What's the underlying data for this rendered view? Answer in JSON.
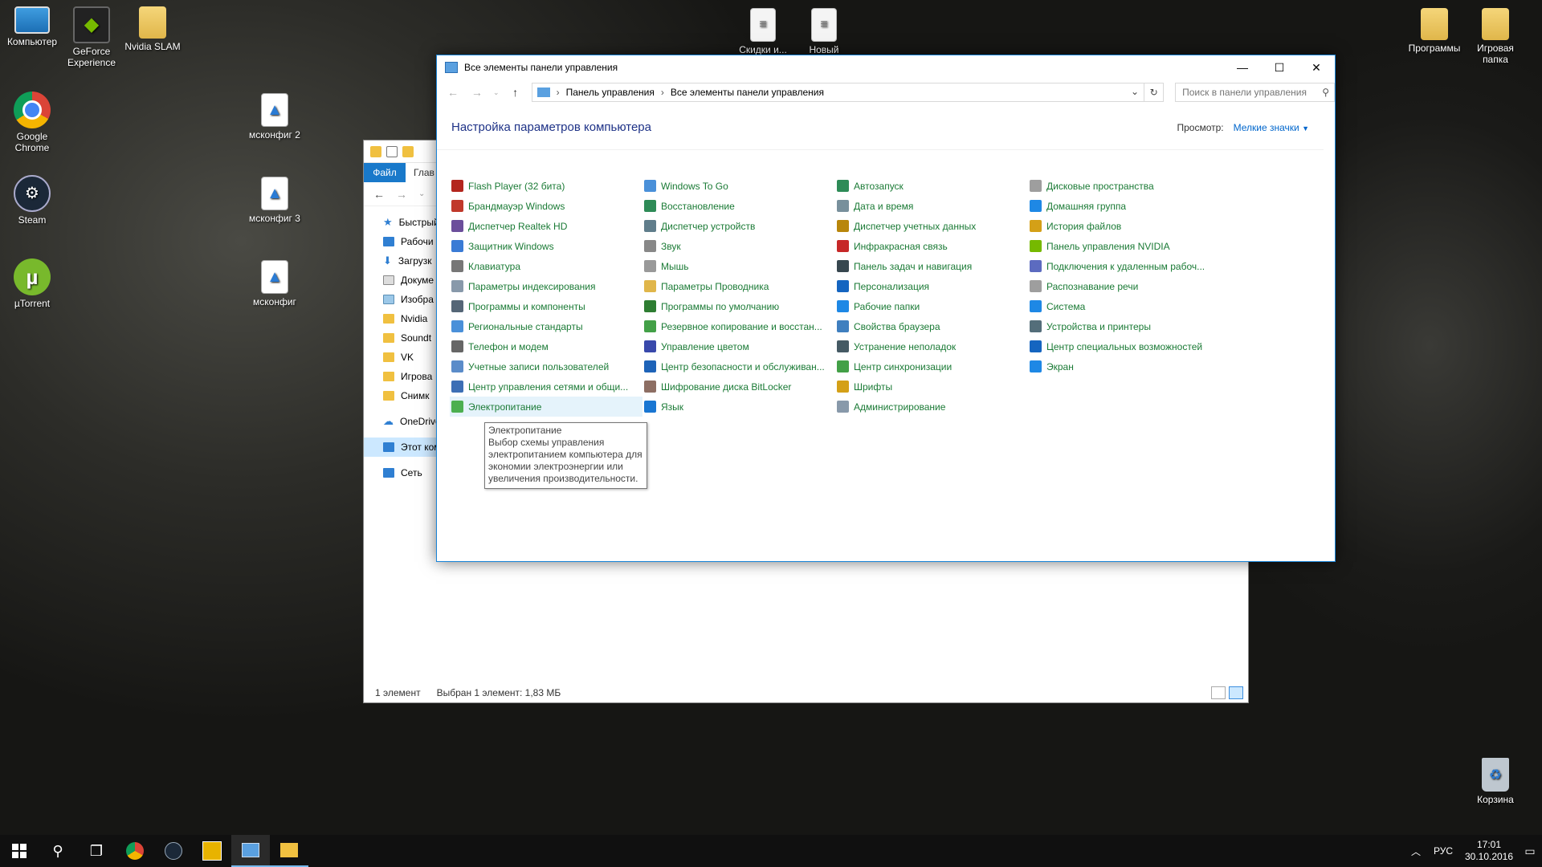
{
  "desktop": {
    "icons_left": [
      {
        "label": "Компьютер",
        "icon": "computer-icon"
      },
      {
        "label": "GeForce Experience",
        "icon": "geforce-icon"
      },
      {
        "label": "Nvidia SLAM",
        "icon": "folder-icon"
      },
      {
        "label": "Google Chrome",
        "icon": "chrome-icon"
      },
      {
        "label": "Steam",
        "icon": "steam-icon"
      },
      {
        "label": "µTorrent",
        "icon": "utorrent-icon"
      }
    ],
    "icons_images": [
      {
        "label": "мсконфиг 2"
      },
      {
        "label": "мсконфиг 3"
      },
      {
        "label": "мсконфиг"
      }
    ],
    "icons_top": [
      {
        "label": "Скидки и..."
      },
      {
        "label": "Новый"
      }
    ],
    "icons_right": [
      {
        "label": "Программы"
      },
      {
        "label": "Игровая папка"
      }
    ],
    "recycle_bin": "Корзина"
  },
  "explorer": {
    "ribbon": {
      "file_tab": "Файл",
      "home_tab": "Глав"
    },
    "sidebar": [
      {
        "label": "Быстрый",
        "type": "star"
      },
      {
        "label": "Рабочи",
        "type": "blue"
      },
      {
        "label": "Загрузк",
        "type": "down"
      },
      {
        "label": "Докуме",
        "type": "doc"
      },
      {
        "label": "Изобра",
        "type": "img"
      },
      {
        "label": "Nvidia",
        "type": "folder"
      },
      {
        "label": "Soundt",
        "type": "folder"
      },
      {
        "label": "VK",
        "type": "folder"
      },
      {
        "label": "Игрова",
        "type": "folder"
      },
      {
        "label": "Снимк",
        "type": "folder"
      },
      {
        "label": "OneDrive",
        "type": "cloud"
      },
      {
        "label": "Этот ком",
        "type": "pc"
      },
      {
        "label": "Сеть",
        "type": "net"
      }
    ],
    "status": {
      "count": "1 элемент",
      "selected": "Выбран 1 элемент: 1,83 МБ"
    }
  },
  "control_panel": {
    "window_title": "Все элементы панели управления",
    "breadcrumb": [
      "Панель управления",
      "Все элементы панели управления"
    ],
    "search_placeholder": "Поиск в панели управления",
    "heading": "Настройка параметров компьютера",
    "view_label": "Просмотр:",
    "view_mode": "Мелкие значки",
    "items": [
      {
        "label": "Flash Player (32 бита)",
        "color": "#b3261e"
      },
      {
        "label": "Брандмауэр Windows",
        "color": "#c0392b"
      },
      {
        "label": "Диспетчер Realtek HD",
        "color": "#6b4e9b"
      },
      {
        "label": "Защитник Windows",
        "color": "#3a7bd5"
      },
      {
        "label": "Клавиатура",
        "color": "#777777"
      },
      {
        "label": "Параметры индексирования",
        "color": "#8899aa"
      },
      {
        "label": "Программы и компоненты",
        "color": "#556677"
      },
      {
        "label": "Региональные стандарты",
        "color": "#4a90d9"
      },
      {
        "label": "Телефон и модем",
        "color": "#666666"
      },
      {
        "label": "Учетные записи пользователей",
        "color": "#5b8cc9"
      },
      {
        "label": "Центр управления сетями и общи...",
        "color": "#3d6fb5"
      },
      {
        "label": "Электропитание",
        "color": "#4caf50"
      },
      {
        "label": "Windows To Go",
        "color": "#4a90d9"
      },
      {
        "label": "Восстановление",
        "color": "#2e8b57"
      },
      {
        "label": "Диспетчер устройств",
        "color": "#607d8b"
      },
      {
        "label": "Звук",
        "color": "#888888"
      },
      {
        "label": "Мышь",
        "color": "#999999"
      },
      {
        "label": "Параметры Проводника",
        "color": "#e0b64a"
      },
      {
        "label": "Программы по умолчанию",
        "color": "#2e7d32"
      },
      {
        "label": "Резервное копирование и восстан...",
        "color": "#43a047"
      },
      {
        "label": "Управление цветом",
        "color": "#3949ab"
      },
      {
        "label": "Центр безопасности и обслуживан...",
        "color": "#1e63b8"
      },
      {
        "label": "Шифрование диска BitLocker",
        "color": "#8d6e63"
      },
      {
        "label": "Язык",
        "color": "#1976d2"
      },
      {
        "label": "Автозапуск",
        "color": "#2e8b57"
      },
      {
        "label": "Дата и время",
        "color": "#78909c"
      },
      {
        "label": "Диспетчер учетных данных",
        "color": "#b8860b"
      },
      {
        "label": "Инфракрасная связь",
        "color": "#c62828"
      },
      {
        "label": "Панель задач и навигация",
        "color": "#37474f"
      },
      {
        "label": "Персонализация",
        "color": "#1565c0"
      },
      {
        "label": "Рабочие папки",
        "color": "#1e88e5"
      },
      {
        "label": "Свойства браузера",
        "color": "#3f7fbf"
      },
      {
        "label": "Устранение неполадок",
        "color": "#455a64"
      },
      {
        "label": "Центр синхронизации",
        "color": "#43a047"
      },
      {
        "label": "Шрифты",
        "color": "#d4a017"
      },
      {
        "label": "Администрирование",
        "color": "#8899aa"
      },
      {
        "label": "Дисковые пространства",
        "color": "#9e9e9e"
      },
      {
        "label": "Домашняя группа",
        "color": "#1e88e5"
      },
      {
        "label": "История файлов",
        "color": "#d4a017"
      },
      {
        "label": "Панель управления NVIDIA",
        "color": "#76b900"
      },
      {
        "label": "Подключения к удаленным рабоч...",
        "color": "#5c6bc0"
      },
      {
        "label": "Распознавание речи",
        "color": "#9e9e9e"
      },
      {
        "label": "Система",
        "color": "#1e88e5"
      },
      {
        "label": "Устройства и принтеры",
        "color": "#546e7a"
      },
      {
        "label": "Центр специальных возможностей",
        "color": "#1565c0"
      },
      {
        "label": "Экран",
        "color": "#1e88e5"
      }
    ],
    "tooltip": {
      "title": "Электропитание",
      "text": "Выбор схемы управления электропитанием компьютера для экономии электроэнергии или увеличения производительности."
    }
  },
  "taskbar": {
    "language": "РУС",
    "time": "17:01",
    "date": "30.10.2016"
  }
}
